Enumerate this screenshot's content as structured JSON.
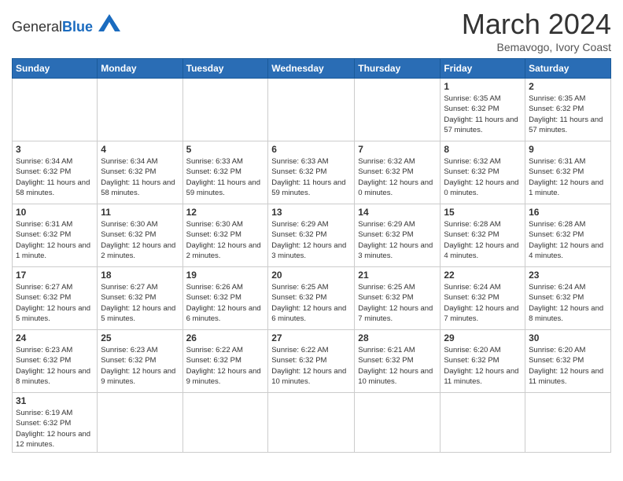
{
  "header": {
    "logo_general": "General",
    "logo_blue": "Blue",
    "month_year": "March 2024",
    "location": "Bemavogo, Ivory Coast"
  },
  "days_of_week": [
    "Sunday",
    "Monday",
    "Tuesday",
    "Wednesday",
    "Thursday",
    "Friday",
    "Saturday"
  ],
  "weeks": [
    [
      {
        "day": "",
        "info": ""
      },
      {
        "day": "",
        "info": ""
      },
      {
        "day": "",
        "info": ""
      },
      {
        "day": "",
        "info": ""
      },
      {
        "day": "",
        "info": ""
      },
      {
        "day": "1",
        "info": "Sunrise: 6:35 AM\nSunset: 6:32 PM\nDaylight: 11 hours\nand 57 minutes."
      },
      {
        "day": "2",
        "info": "Sunrise: 6:35 AM\nSunset: 6:32 PM\nDaylight: 11 hours\nand 57 minutes."
      }
    ],
    [
      {
        "day": "3",
        "info": "Sunrise: 6:34 AM\nSunset: 6:32 PM\nDaylight: 11 hours\nand 58 minutes."
      },
      {
        "day": "4",
        "info": "Sunrise: 6:34 AM\nSunset: 6:32 PM\nDaylight: 11 hours\nand 58 minutes."
      },
      {
        "day": "5",
        "info": "Sunrise: 6:33 AM\nSunset: 6:32 PM\nDaylight: 11 hours\nand 59 minutes."
      },
      {
        "day": "6",
        "info": "Sunrise: 6:33 AM\nSunset: 6:32 PM\nDaylight: 11 hours\nand 59 minutes."
      },
      {
        "day": "7",
        "info": "Sunrise: 6:32 AM\nSunset: 6:32 PM\nDaylight: 12 hours\nand 0 minutes."
      },
      {
        "day": "8",
        "info": "Sunrise: 6:32 AM\nSunset: 6:32 PM\nDaylight: 12 hours\nand 0 minutes."
      },
      {
        "day": "9",
        "info": "Sunrise: 6:31 AM\nSunset: 6:32 PM\nDaylight: 12 hours\nand 1 minute."
      }
    ],
    [
      {
        "day": "10",
        "info": "Sunrise: 6:31 AM\nSunset: 6:32 PM\nDaylight: 12 hours\nand 1 minute."
      },
      {
        "day": "11",
        "info": "Sunrise: 6:30 AM\nSunset: 6:32 PM\nDaylight: 12 hours\nand 2 minutes."
      },
      {
        "day": "12",
        "info": "Sunrise: 6:30 AM\nSunset: 6:32 PM\nDaylight: 12 hours\nand 2 minutes."
      },
      {
        "day": "13",
        "info": "Sunrise: 6:29 AM\nSunset: 6:32 PM\nDaylight: 12 hours\nand 3 minutes."
      },
      {
        "day": "14",
        "info": "Sunrise: 6:29 AM\nSunset: 6:32 PM\nDaylight: 12 hours\nand 3 minutes."
      },
      {
        "day": "15",
        "info": "Sunrise: 6:28 AM\nSunset: 6:32 PM\nDaylight: 12 hours\nand 4 minutes."
      },
      {
        "day": "16",
        "info": "Sunrise: 6:28 AM\nSunset: 6:32 PM\nDaylight: 12 hours\nand 4 minutes."
      }
    ],
    [
      {
        "day": "17",
        "info": "Sunrise: 6:27 AM\nSunset: 6:32 PM\nDaylight: 12 hours\nand 5 minutes."
      },
      {
        "day": "18",
        "info": "Sunrise: 6:27 AM\nSunset: 6:32 PM\nDaylight: 12 hours\nand 5 minutes."
      },
      {
        "day": "19",
        "info": "Sunrise: 6:26 AM\nSunset: 6:32 PM\nDaylight: 12 hours\nand 6 minutes."
      },
      {
        "day": "20",
        "info": "Sunrise: 6:25 AM\nSunset: 6:32 PM\nDaylight: 12 hours\nand 6 minutes."
      },
      {
        "day": "21",
        "info": "Sunrise: 6:25 AM\nSunset: 6:32 PM\nDaylight: 12 hours\nand 7 minutes."
      },
      {
        "day": "22",
        "info": "Sunrise: 6:24 AM\nSunset: 6:32 PM\nDaylight: 12 hours\nand 7 minutes."
      },
      {
        "day": "23",
        "info": "Sunrise: 6:24 AM\nSunset: 6:32 PM\nDaylight: 12 hours\nand 8 minutes."
      }
    ],
    [
      {
        "day": "24",
        "info": "Sunrise: 6:23 AM\nSunset: 6:32 PM\nDaylight: 12 hours\nand 8 minutes."
      },
      {
        "day": "25",
        "info": "Sunrise: 6:23 AM\nSunset: 6:32 PM\nDaylight: 12 hours\nand 9 minutes."
      },
      {
        "day": "26",
        "info": "Sunrise: 6:22 AM\nSunset: 6:32 PM\nDaylight: 12 hours\nand 9 minutes."
      },
      {
        "day": "27",
        "info": "Sunrise: 6:22 AM\nSunset: 6:32 PM\nDaylight: 12 hours\nand 10 minutes."
      },
      {
        "day": "28",
        "info": "Sunrise: 6:21 AM\nSunset: 6:32 PM\nDaylight: 12 hours\nand 10 minutes."
      },
      {
        "day": "29",
        "info": "Sunrise: 6:20 AM\nSunset: 6:32 PM\nDaylight: 12 hours\nand 11 minutes."
      },
      {
        "day": "30",
        "info": "Sunrise: 6:20 AM\nSunset: 6:32 PM\nDaylight: 12 hours\nand 11 minutes."
      }
    ],
    [
      {
        "day": "31",
        "info": "Sunrise: 6:19 AM\nSunset: 6:32 PM\nDaylight: 12 hours\nand 12 minutes."
      },
      {
        "day": "",
        "info": ""
      },
      {
        "day": "",
        "info": ""
      },
      {
        "day": "",
        "info": ""
      },
      {
        "day": "",
        "info": ""
      },
      {
        "day": "",
        "info": ""
      },
      {
        "day": "",
        "info": ""
      }
    ]
  ]
}
